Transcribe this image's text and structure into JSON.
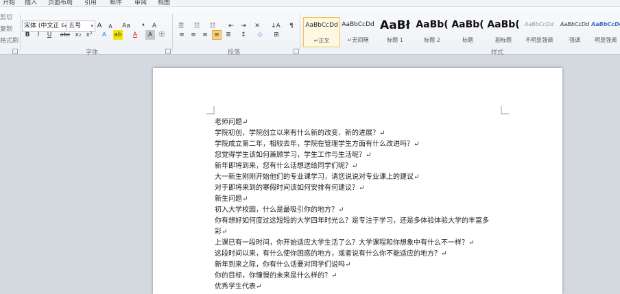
{
  "menu": [
    {
      "label": "开始"
    },
    {
      "label": "插入"
    },
    {
      "label": "页面布局"
    },
    {
      "label": "引用"
    },
    {
      "label": "邮件"
    },
    {
      "label": "审阅"
    },
    {
      "label": "视图"
    }
  ],
  "clipboard": {
    "cut": "剪切",
    "copy": "复制",
    "painter": "格式刷"
  },
  "font_group": {
    "font_name": "宋体 (中文正ゞ",
    "font_size": "五号",
    "grow": "A",
    "shrink": "A",
    "change_case": "Aa",
    "phonetic": "ᵜ",
    "char_border": "A",
    "bold": "B",
    "italic": "I",
    "underline": "U",
    "strike": "abc",
    "subscript": "x₂",
    "superscript": "x²",
    "text_effect": "A",
    "highlight": "ab",
    "font_color": "A",
    "char_shade": "A",
    "enclose": "㊉",
    "label": "字体",
    "accent_color": "#d42020",
    "highlight_color": "#f2e600"
  },
  "paragraph_group": {
    "bullets": "☰",
    "numbering": "☷",
    "multilevel": "☷",
    "decrease_indent": "⇤",
    "increase_indent": "⇥",
    "chinese_layout": "✕",
    "sort": "↓A",
    "show_marks": "¶",
    "align_left": "≡",
    "center": "≡",
    "align_right": "≡",
    "justify": "≡",
    "distributed": "≣",
    "line_spacing": "↕",
    "shading": "◇",
    "borders": "⊞",
    "label": "段落"
  },
  "styles_group": {
    "label": "样式",
    "tiles": [
      {
        "sample": "AaBbCcDd",
        "name": "↵正文"
      },
      {
        "sample": "AaBbCcDd",
        "name": "↵无间隔"
      },
      {
        "sample": "AaBł",
        "name": "标题 1"
      },
      {
        "sample": "AaBb(",
        "name": "标题 2"
      },
      {
        "sample": "AaBb(",
        "name": "标题"
      },
      {
        "sample": "AaBb(",
        "name": "副标题"
      },
      {
        "sample": "AaBbCcDd",
        "name": "不明显强调"
      },
      {
        "sample": "AaBbCcDd",
        "name": "强调"
      },
      {
        "sample": "AaBbCcDd",
        "name": "明显强调"
      }
    ]
  },
  "document": {
    "lines": [
      "老师问题↵",
      "学院初创，学院创立以来有什么新的改变、新的进展？↵",
      "学院成立第二年，相较去年，学院在管理学生方面有什么改进吗？↵",
      "您觉得学生该如何兼顾学习，学生工作与生活呢？↵",
      "新年即将到来，您有什么话想送给同学们呢？↵",
      "大一新生刚刚开始他们的专业课学习，请您说说对专业课上的建议↵",
      "对于即将来到的寒假时间该如何安排有何建议？↵",
      "新生问题↵",
      "初入大学校园，什么是最吸引你的地方？↵",
      "你有想好如何度过这短短的大学四年时光么？是专注于学习，还是多体验体验大学的丰富多",
      "彩↵",
      "上课已有一段时间，你开始适应大学生活了么？大学课程和你想象中有什么不一样？↵",
      "这段时间以来，有什么使你困惑的地方，或者说有什么你不能适应的地方？↵",
      "新年到来之际，你有什么话要对同学们说吗↵",
      "你的目标，你憧憬的未来是什么样的？↵",
      "优秀学生代表↵"
    ]
  }
}
